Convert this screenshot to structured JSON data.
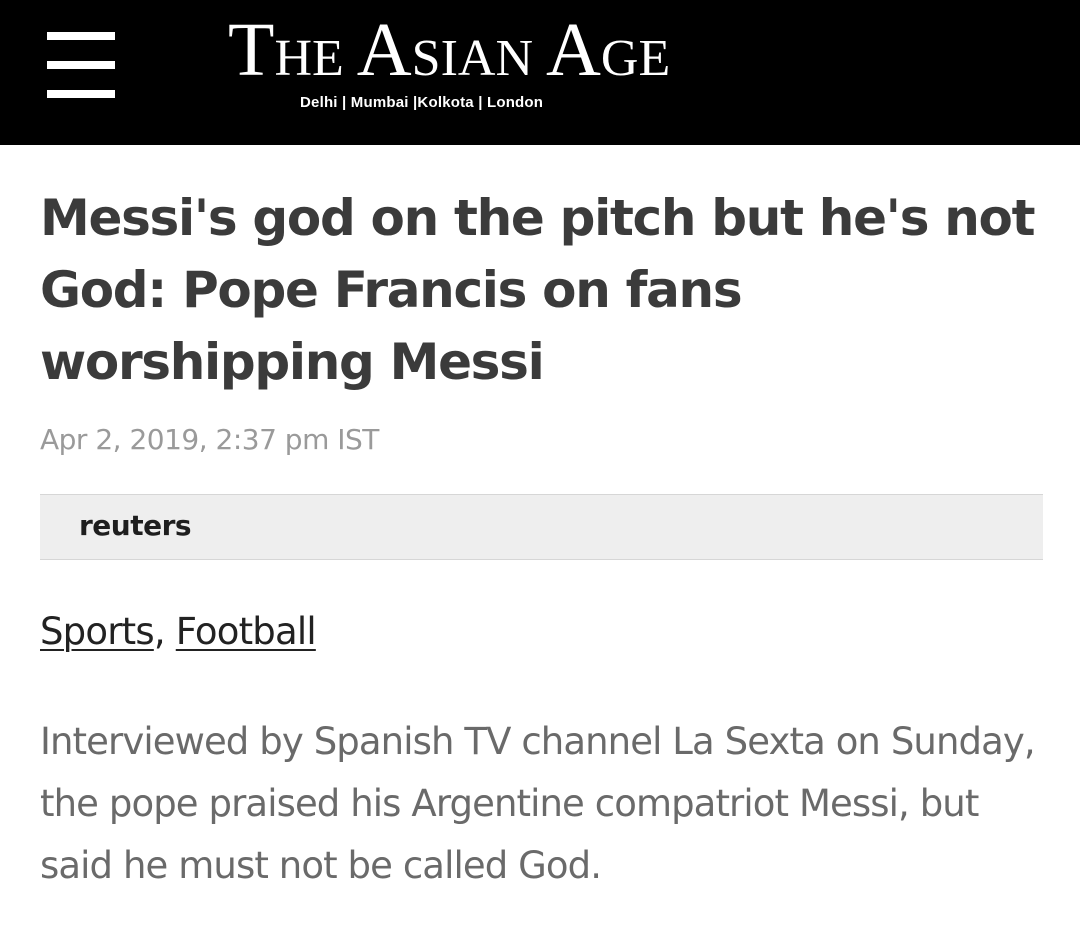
{
  "header": {
    "logo_title_first": "T",
    "logo_title_rest_1": "HE ",
    "logo_title_a": "A",
    "logo_title_rest_2": "SIAN ",
    "logo_title_a2": "A",
    "logo_title_rest_3": "GE",
    "logo_cities": "Delhi | Mumbai |Kolkota | London",
    "menu_icon": "hamburger-menu-icon"
  },
  "article": {
    "headline": "Messi's god on the pitch but he's not God: Pope Francis on fans worshipping Messi",
    "dateline": "Apr 2, 2019, 2:37 pm IST",
    "source": "reuters",
    "tags": [
      "Sports",
      "Football"
    ],
    "tag_separator": ", ",
    "body": "Interviewed by Spanish TV channel La Sexta on Sunday, the pope praised his Argentine compatriot Messi, but said he must not be called God."
  },
  "colors": {
    "header_bg": "#000000",
    "headline": "#3b3b3b",
    "dateline": "#9a9a9a",
    "source_box_bg": "#eeeeee",
    "body_text": "#6a6a6a"
  }
}
